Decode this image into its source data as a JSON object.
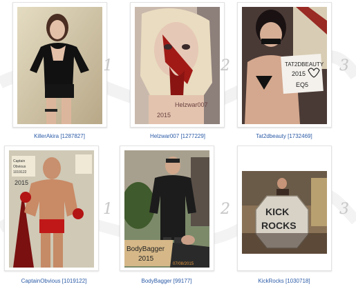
{
  "entries": [
    {
      "name": "KillerAkira",
      "id": "[1287827]",
      "rank": "1"
    },
    {
      "name": "Helzwar007",
      "id": "[1277229]",
      "rank": "2"
    },
    {
      "name": "Tat2dbeauty",
      "id": "[1732469]",
      "rank": "3"
    },
    {
      "name": "CaptainObvious",
      "id": "[1019122]",
      "rank": "1"
    },
    {
      "name": "BodyBagger",
      "id": "[99177]",
      "rank": "2"
    },
    {
      "name": "KickRocks",
      "id": "[1030718]",
      "rank": "3"
    }
  ],
  "photo_text": {
    "helzwar_sign": "Helzwar007",
    "helzwar_year": "2015",
    "tat2d_sign_line1": "TAT2DBEAUTY",
    "tat2d_sign_line2": "2015",
    "tat2d_sign_line3": "EQ5",
    "captain_sign_line1": "Captain",
    "captain_sign_line2": "Obvious",
    "captain_sign_line3": "1019122",
    "captain_year": "2015",
    "bodybagger_sign_line1": "BodyBagger",
    "bodybagger_sign_line2": "2015",
    "bodybagger_date": "07/08/2015",
    "kickrocks_line1": "KICK",
    "kickrocks_line2": "ROCKS"
  },
  "colors": {
    "caption_link": "#2a5aa6",
    "rank_numeral": "#c8c8c8"
  }
}
